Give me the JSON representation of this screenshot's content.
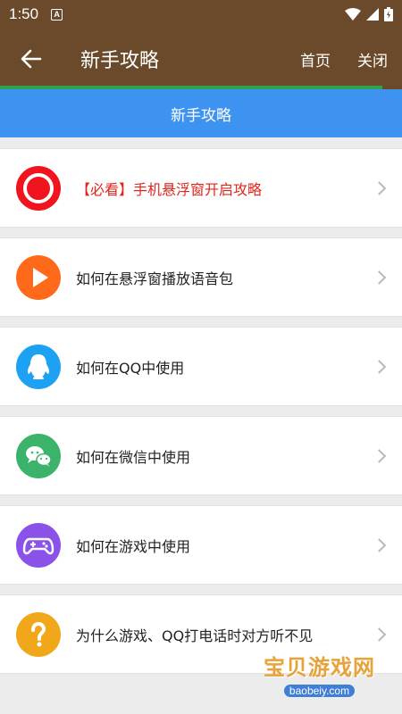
{
  "status_bar": {
    "time": "1:50",
    "a_badge": "A"
  },
  "app_bar": {
    "title": "新手攻略",
    "home_label": "首页",
    "close_label": "关闭"
  },
  "tab": {
    "label": "新手攻略"
  },
  "items": [
    {
      "label": "【必看】手机悬浮窗开启攻略",
      "icon": "record-icon",
      "color": "#f0141e"
    },
    {
      "label": "如何在悬浮窗播放语音包",
      "icon": "play-icon",
      "color": "#ff6a1a"
    },
    {
      "label": "如何在QQ中使用",
      "icon": "qq-icon",
      "color": "#1da1f2"
    },
    {
      "label": "如何在微信中使用",
      "icon": "wechat-icon",
      "color": "#3bb36b"
    },
    {
      "label": "如何在游戏中使用",
      "icon": "gamepad-icon",
      "color": "#8a52e8"
    },
    {
      "label": "为什么游戏、QQ打电话时对方听不见",
      "icon": "question-icon",
      "color": "#f0a81a"
    }
  ],
  "watermark": {
    "text": "宝贝游戏网",
    "url": "baobeiy.com"
  }
}
